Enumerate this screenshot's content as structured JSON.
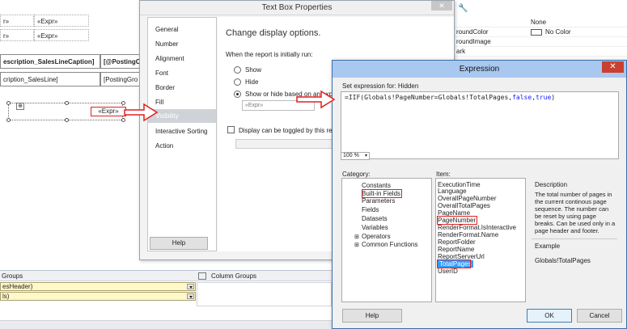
{
  "designer": {
    "cells": [
      "r»",
      "«Expr»",
      "r»",
      "«Expr»",
      "escription_SalesLineCaption]",
      "[@PostingC",
      "cription_SalesLine]",
      "[PostingGro"
    ],
    "textbox_expr": "«Expr»",
    "groups_label": "Groups",
    "column_groups_label": "Column Groups",
    "group_rows": [
      "esHeader)",
      "ls)"
    ]
  },
  "properties_panel": {
    "rows": [
      {
        "name": "",
        "value": "None"
      },
      {
        "name": "roundColor",
        "value": "No Color"
      },
      {
        "name": "roundImage",
        "value": ""
      },
      {
        "name": "ark",
        "value": ""
      }
    ]
  },
  "textbox_dialog": {
    "title": "Text Box Properties",
    "close": "✕",
    "nav": [
      "General",
      "Number",
      "Alignment",
      "Font",
      "Border",
      "Fill",
      "Visibility",
      "Interactive Sorting",
      "Action"
    ],
    "selected_nav": "Visibility",
    "heading": "Change display options.",
    "when_label": "When the report is initially run:",
    "options": [
      "Show",
      "Hide",
      "Show or hide based on an exp"
    ],
    "expr_field": "«Expr»",
    "toggle_label": "Display can be toggled by this rep",
    "help": "Help"
  },
  "expression_dialog": {
    "title": "Expression",
    "close": "✕",
    "set_label": "Set expression for: Hidden",
    "expression_parts": [
      "=IIF(Globals!PageNumber=Globals!TotalPages,",
      "false",
      ",",
      "true",
      ")"
    ],
    "zoom": "100 %",
    "category_label": "Category:",
    "item_label": "Item:",
    "categories": [
      "Constants",
      "Built-in Fields",
      "Parameters",
      "Fields",
      "Datasets",
      "Variables",
      "Operators",
      "Common Functions"
    ],
    "items": [
      "ExecutionTime",
      "Language",
      "OverallPageNumber",
      "OverallTotalPages",
      "PageName",
      "PageNumber",
      "RenderFormat.IsInteractive",
      "RenderFormat.Name",
      "ReportFolder",
      "ReportName",
      "ReportServerUrl",
      "TotalPages",
      "UserID"
    ],
    "selected_item": "TotalPages",
    "description_label": "Description",
    "description": "The total number of pages in the current continous page sequence. The number can be reset by using page breaks. Can be used only in a page header and footer.",
    "example_label": "Example",
    "example": "Globals!TotalPages",
    "help": "Help",
    "ok": "OK",
    "cancel": "Cancel"
  },
  "colors": {
    "annotation_red": "#e02020",
    "selection_blue": "#3399ff",
    "expr_title_bar": "#a9c8f0"
  }
}
